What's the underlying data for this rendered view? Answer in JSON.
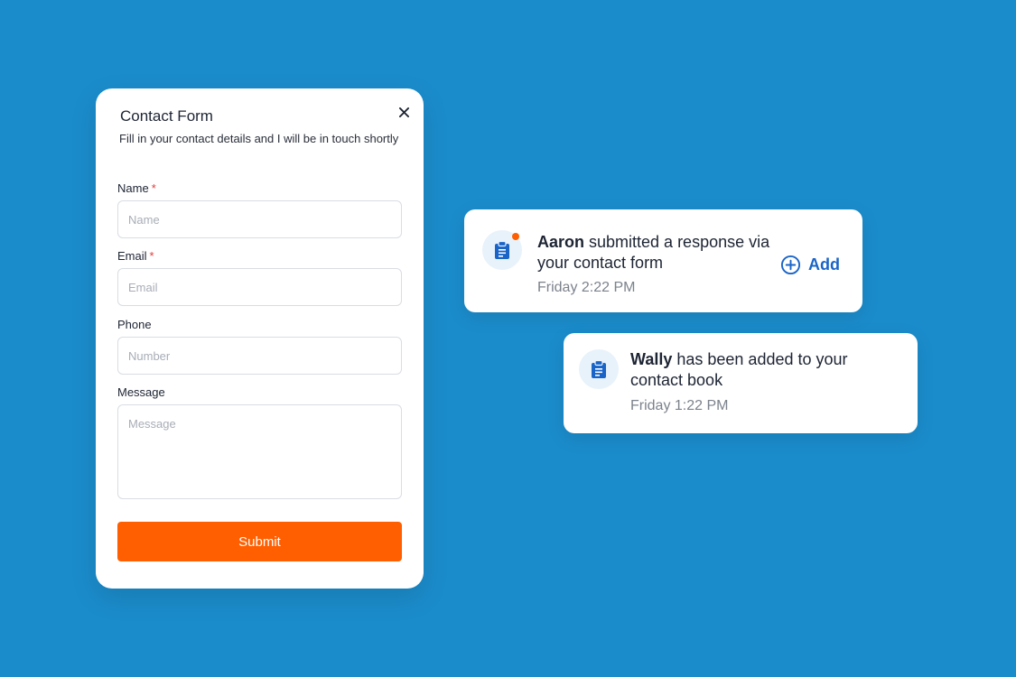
{
  "contact_form": {
    "title": "Contact Form",
    "subtitle": "Fill in your contact details and I will be in touch shortly",
    "fields": {
      "name": {
        "label": "Name",
        "required_mark": "*",
        "placeholder": "Name"
      },
      "email": {
        "label": "Email",
        "required_mark": "*",
        "placeholder": "Email"
      },
      "phone": {
        "label": "Phone",
        "placeholder": "Number"
      },
      "message": {
        "label": "Message",
        "placeholder": "Message"
      }
    },
    "submit_label": "Submit"
  },
  "notifications": [
    {
      "who": "Aaron",
      "text": " submitted a response via your contact form",
      "time": "Friday 2:22 PM",
      "action_label": "Add",
      "unread": true
    },
    {
      "who": "Wally",
      "text": " has been added to your contact book",
      "time": "Friday 1:22 PM"
    }
  ],
  "icons": {
    "close": "close-icon",
    "clipboard": "clipboard-icon",
    "add": "plus-circle-icon"
  },
  "colors": {
    "background": "#1b8ccb",
    "submit": "#ff5f00",
    "accent": "#1a64c8",
    "unread_dot": "#ff5f00",
    "required": "#e23b3b"
  }
}
